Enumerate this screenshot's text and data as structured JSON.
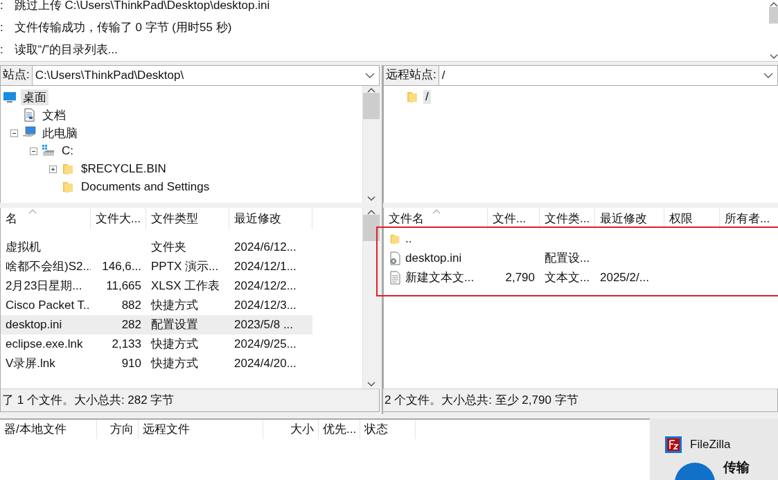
{
  "log": [
    {
      "prefix": ":",
      "text": "跳过上传 C:\\Users\\ThinkPad\\Desktop\\desktop.ini"
    },
    {
      "prefix": ":",
      "text": "文件传输成功，传输了 0 字节 (用时55 秒)"
    },
    {
      "prefix": ":",
      "text": "读取“/”的目录列表..."
    }
  ],
  "local": {
    "site_label": "站点:",
    "path": "C:\\Users\\ThinkPad\\Desktop\\",
    "tree": [
      {
        "label": "桌面",
        "kind": "desktop",
        "selected": true,
        "children": [
          {
            "label": "文档",
            "kind": "document",
            "selected": false
          },
          {
            "label": "此电脑",
            "kind": "computer",
            "selected": false,
            "expanded": true,
            "children": [
              {
                "label": "C:",
                "kind": "drive",
                "selected": false,
                "expanded": true,
                "children": [
                  {
                    "label": "$RECYCLE.BIN",
                    "kind": "folder",
                    "selected": false,
                    "expanded": false
                  },
                  {
                    "label": "Documents and Settings",
                    "kind": "folder",
                    "selected": false
                  }
                ]
              }
            ]
          }
        ]
      }
    ],
    "columns": [
      {
        "label": "名",
        "sorted": true
      },
      {
        "label": "文件大...",
        "sorted": false
      },
      {
        "label": "文件类型",
        "sorted": false
      },
      {
        "label": "最近修改",
        "sorted": false
      }
    ],
    "rows": [
      {
        "name": "虚拟机",
        "size": "",
        "type": "文件夹",
        "modified": "2024/6/12...",
        "selected": false
      },
      {
        "name": "啥都不会组)S2...",
        "size": "146,6...",
        "type": "PPTX 演示...",
        "modified": "2024/12/1...",
        "selected": false
      },
      {
        "name": "2月23日星期...",
        "size": "11,665",
        "type": "XLSX 工作表",
        "modified": "2024/12/2...",
        "selected": false
      },
      {
        "name": "Cisco Packet T...",
        "size": "882",
        "type": "快捷方式",
        "modified": "2024/12/3...",
        "selected": false
      },
      {
        "name": "desktop.ini",
        "size": "282",
        "type": "配置设置",
        "modified": "2023/5/8 ...",
        "selected": true
      },
      {
        "name": "eclipse.exe.lnk",
        "size": "2,133",
        "type": "快捷方式",
        "modified": "2024/9/25...",
        "selected": false
      },
      {
        "name": "V录屏.lnk",
        "size": "910",
        "type": "快捷方式",
        "modified": "2024/4/20...",
        "selected": false
      }
    ],
    "status": "了 1 个文件。大小总共: 282 字节"
  },
  "remote": {
    "site_label": "远程站点:",
    "path": "/",
    "tree": [
      {
        "label": "/",
        "kind": "folder",
        "selected": true
      }
    ],
    "columns": [
      {
        "label": "文件名",
        "sorted": true
      },
      {
        "label": "文件...",
        "sorted": false
      },
      {
        "label": "文件类...",
        "sorted": false
      },
      {
        "label": "最近修改",
        "sorted": false
      },
      {
        "label": "权限",
        "sorted": false
      },
      {
        "label": "所有者...",
        "sorted": false
      }
    ],
    "rows": [
      {
        "name": "..",
        "kind": "folder",
        "size": "",
        "type": "",
        "modified": "",
        "selected": false
      },
      {
        "name": "desktop.ini",
        "kind": "settings",
        "size": "",
        "type": "配置设...",
        "modified": "",
        "selected": false
      },
      {
        "name": "新建文本文...",
        "kind": "text",
        "size": "2,790",
        "type": "文本文...",
        "modified": "2025/2/...",
        "selected": false
      }
    ],
    "status": "2 个文件。大小总共: 至少 2,790 字节"
  },
  "queue": {
    "columns": [
      "器/本地文件",
      "方向",
      "远程文件",
      "大小",
      "优先...",
      "状态"
    ]
  },
  "notification": {
    "app": "FileZilla",
    "title": "传输"
  }
}
